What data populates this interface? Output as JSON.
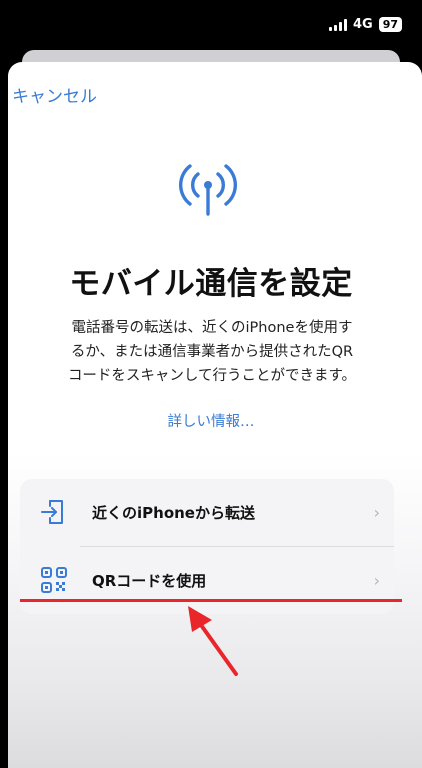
{
  "status_bar": {
    "network": "4G",
    "battery": "97"
  },
  "sheet": {
    "cancel_label": "キャンセル",
    "title": "モバイル通信を設定",
    "description_lines": [
      "電話番号の転送は、近くのiPhoneを使用す",
      "るか、または通信事業者から提供されたQR",
      "コードをスキャンして行うことができます。"
    ],
    "more_info_link": "詳しい情報…",
    "options": [
      {
        "label": "近くのiPhoneから転送",
        "icon": "transfer-in-icon"
      },
      {
        "label": "QRコードを使用",
        "icon": "qr-code-icon"
      }
    ]
  },
  "colors": {
    "accent": "#3a7bd5",
    "annotation": "#e9262a"
  }
}
